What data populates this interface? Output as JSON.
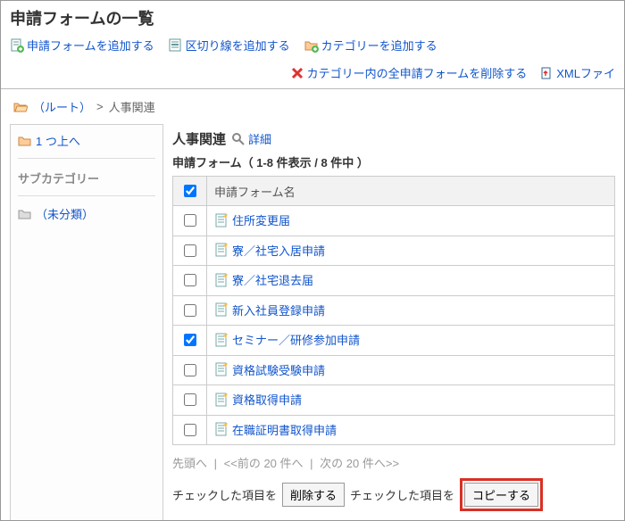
{
  "page": {
    "title": "申請フォームの一覧"
  },
  "actions": {
    "add_form": "申請フォームを追加する",
    "add_divider": "区切り線を追加する",
    "add_category": "カテゴリーを追加する",
    "delete_all": "カテゴリー内の全申請フォームを削除する",
    "xml_file": "XMLファイ"
  },
  "breadcrumb": {
    "root": "（ルート）",
    "sep": ">",
    "current": "人事関連"
  },
  "sidebar": {
    "up_link": "1 つ上へ",
    "subcat_title": "サブカテゴリー",
    "folders": [
      "（未分類）"
    ]
  },
  "main": {
    "title": "人事関連",
    "detail_link": "詳細",
    "subtitle": "申請フォーム（ 1-8 件表示 / 8 件中 ）",
    "col_name": "申請フォーム名",
    "forms": [
      {
        "label": "住所変更届",
        "checked": false
      },
      {
        "label": "寮／社宅入居申請",
        "checked": false
      },
      {
        "label": "寮／社宅退去届",
        "checked": false
      },
      {
        "label": "新入社員登録申請",
        "checked": false
      },
      {
        "label": "セミナー／研修参加申請",
        "checked": true
      },
      {
        "label": "資格試験受験申請",
        "checked": false
      },
      {
        "label": "資格取得申請",
        "checked": false
      },
      {
        "label": "在職証明書取得申請",
        "checked": false
      }
    ]
  },
  "pager": {
    "first": "先頭へ",
    "prev": "<<前の 20 件へ",
    "next": "次の 20 件へ>>"
  },
  "bottom": {
    "checked_prefix": "チェックした項目を",
    "delete_btn": "削除する",
    "copy_btn": "コピーする"
  }
}
